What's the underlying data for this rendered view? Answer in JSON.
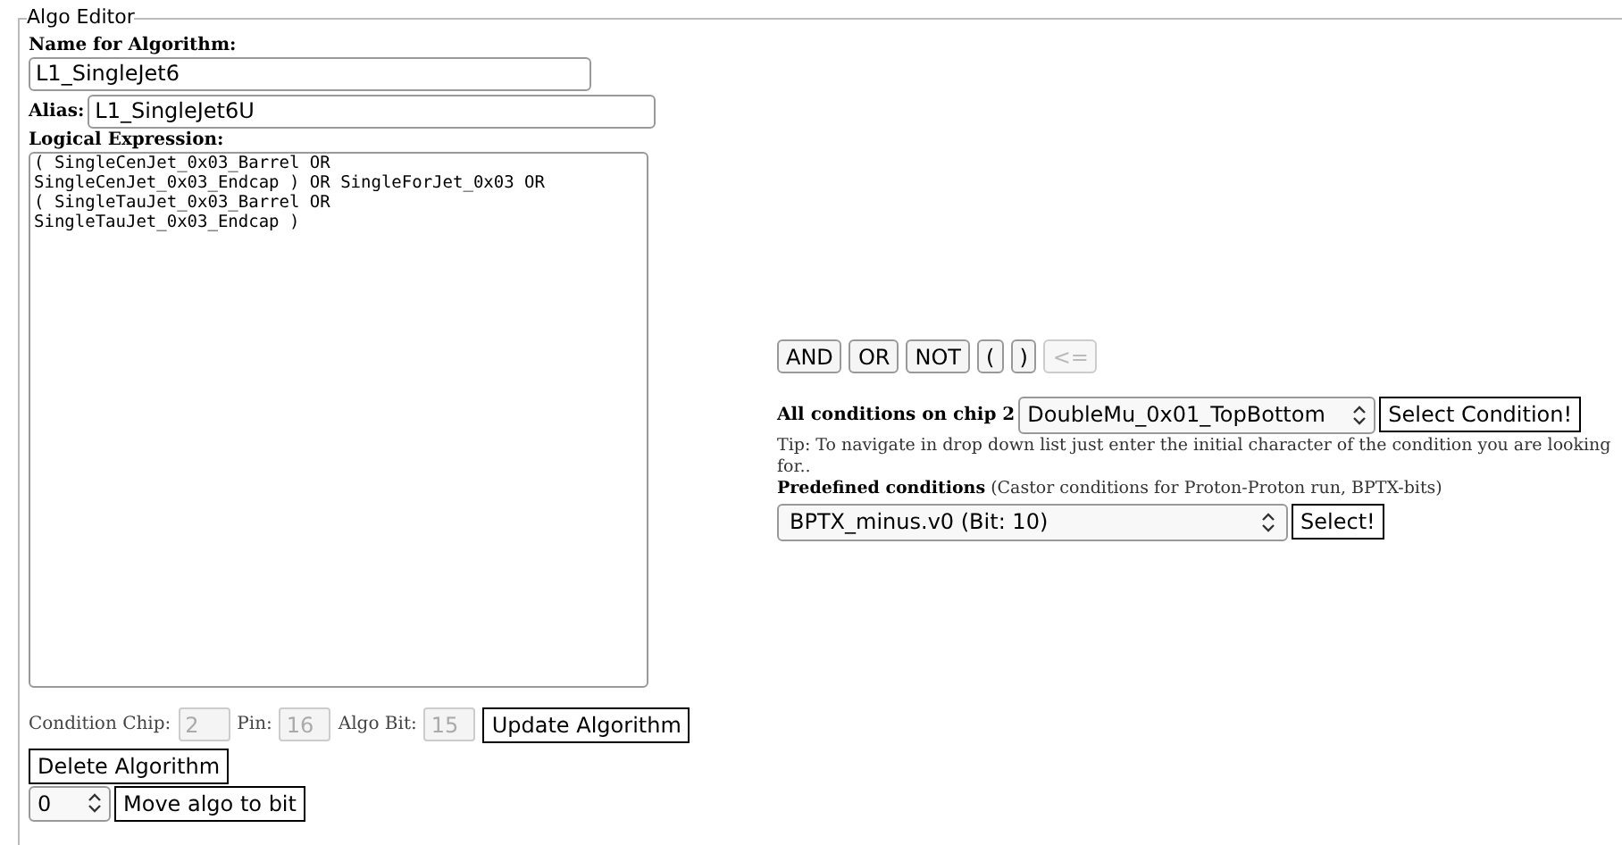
{
  "editor": {
    "legend": "Algo Editor",
    "name_label": "Name for Algorithm:",
    "name_value": "L1_SingleJet6",
    "alias_label": "Alias:",
    "alias_value": "L1_SingleJet6U",
    "expression_label": "Logical Expression:",
    "expression_value": "( SingleCenJet_0x03_Barrel OR\nSingleCenJet_0x03_Endcap ) OR SingleForJet_0x03 OR\n( SingleTauJet_0x03_Barrel OR\nSingleTauJet_0x03_Endcap )",
    "fields": [
      {
        "label": "Condition Chip:",
        "value": "2",
        "disabled": true
      },
      {
        "label": "Pin:",
        "value": "16",
        "disabled": true
      },
      {
        "label": "Algo Bit:",
        "value": "15",
        "disabled": true
      }
    ],
    "update_button": "Update Algorithm",
    "delete_button": "Delete Algorithm",
    "bit_select": "0",
    "move_button": "Move algo to bit"
  },
  "operators": [
    {
      "label": "AND",
      "disabled": false
    },
    {
      "label": "OR",
      "disabled": false
    },
    {
      "label": "NOT",
      "disabled": false
    },
    {
      "label": "(",
      "disabled": false
    },
    {
      "label": ")",
      "disabled": false
    },
    {
      "label": "<=",
      "disabled": true
    }
  ],
  "conditions": {
    "label": "All conditions on chip 2",
    "select": "DoubleMu_0x01_TopBottom",
    "button": "Select Condition!",
    "tip": "Tip: To navigate in drop down list just enter the initial character of the condition you are looking for..",
    "predefined_label": "Predefined conditions",
    "predefined_note": "(Castor conditions for Proton-Proton run, BPTX-bits)",
    "predefined_select": "BPTX_minus.v0 (Bit: 10)",
    "predefined_button": "Select!"
  }
}
